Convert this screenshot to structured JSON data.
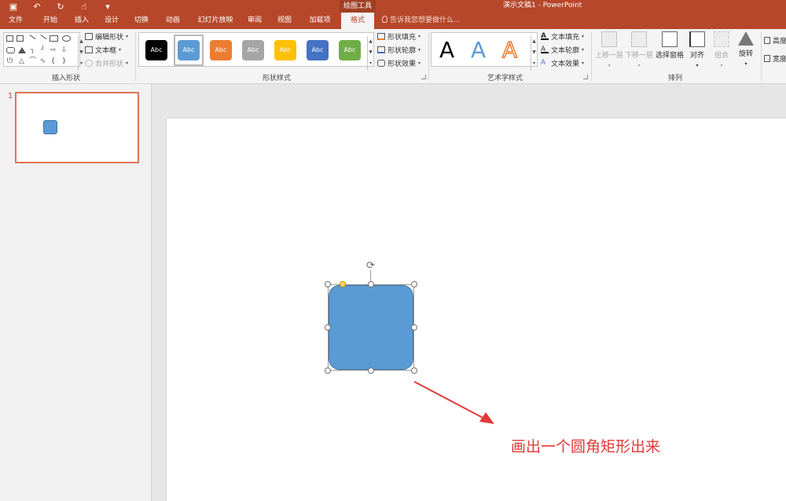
{
  "qat": {
    "save_icon": "save-icon",
    "undo_icon": "undo-icon",
    "redo_icon": "redo-icon",
    "touch_icon": "touch-mode-icon",
    "customize_icon": "customize-icon"
  },
  "title_bar": {
    "context_tool": "绘图工具",
    "doc_title": "演示文稿1 - PowerPoint"
  },
  "tabs": [
    "文件",
    "开始",
    "插入",
    "设计",
    "切换",
    "动画",
    "幻灯片放映",
    "审阅",
    "视图",
    "加载项",
    "格式"
  ],
  "active_tab": "格式",
  "tell_me": "告诉我您想要做什么...",
  "groups": {
    "insert_shapes": {
      "label": "插入形状",
      "edit_shape": "编辑形状",
      "text_box": "文本框",
      "merge_shapes": "合并形状"
    },
    "shape_styles": {
      "label": "形状样式",
      "swatch_text": "Abc",
      "swatches": [
        "#000000",
        "#5b9bd5",
        "#ed7d31",
        "#a5a5a5",
        "#ffc000",
        "#4472c4",
        "#70ad47"
      ],
      "fill": "形状填充",
      "outline": "形状轮廓",
      "effects": "形状效果"
    },
    "wordart": {
      "label": "艺术字样式",
      "letter": "A",
      "text_fill": "文本填充",
      "text_outline": "文本轮廓",
      "text_effects": "文本效果"
    },
    "arrange": {
      "label": "排列",
      "bring_forward": "上移一层",
      "send_backward": "下移一层",
      "selection_pane": "选择窗格",
      "align": "对齐",
      "group": "组合",
      "rotate": "旋转"
    },
    "size": {
      "height": "高度",
      "width": "宽度"
    }
  },
  "slides": [
    {
      "number": "1"
    }
  ],
  "slide": {
    "shape_color": "#5b9bd5",
    "caption": "画出一个圆角矩形出来"
  },
  "colors": {
    "accent": "#b7472a",
    "annotation": "#e03a3a"
  }
}
